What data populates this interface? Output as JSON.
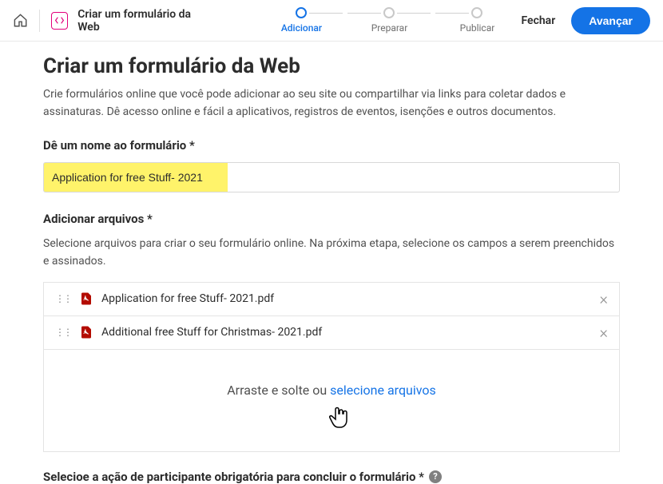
{
  "topbar": {
    "title": "Criar um formulário da Web",
    "steps": [
      {
        "label": "Adicionar",
        "active": true
      },
      {
        "label": "Preparar",
        "active": false
      },
      {
        "label": "Publicar",
        "active": false
      }
    ],
    "close": "Fechar",
    "next": "Avançar"
  },
  "page": {
    "heading": "Criar um formulário da Web",
    "description": "Crie formulários online que você pode adicionar ao seu site ou compartilhar via links para coletar dados e assinaturas. Dê acesso online e fácil a aplicativos, registros de eventos, isenções e outros documentos."
  },
  "formName": {
    "label": "Dê um nome ao formulário *",
    "value": "Application for free Stuff- 2021"
  },
  "files": {
    "label": "Adicionar arquivos *",
    "description": "Selecione arquivos para criar o seu formulário online. Na próxima etapa, selecione os campos a serem preenchidos e assinados.",
    "items": [
      {
        "name": "Application for free Stuff- 2021.pdf"
      },
      {
        "name": "Additional free Stuff for Christmas- 2021.pdf"
      }
    ],
    "dropzone": {
      "prefix": "Arraste e solte ou ",
      "link": "selecione arquivos"
    }
  },
  "participantAction": {
    "label": "Selecioe a ação de participante obrigatória para concluir o formulário *"
  }
}
